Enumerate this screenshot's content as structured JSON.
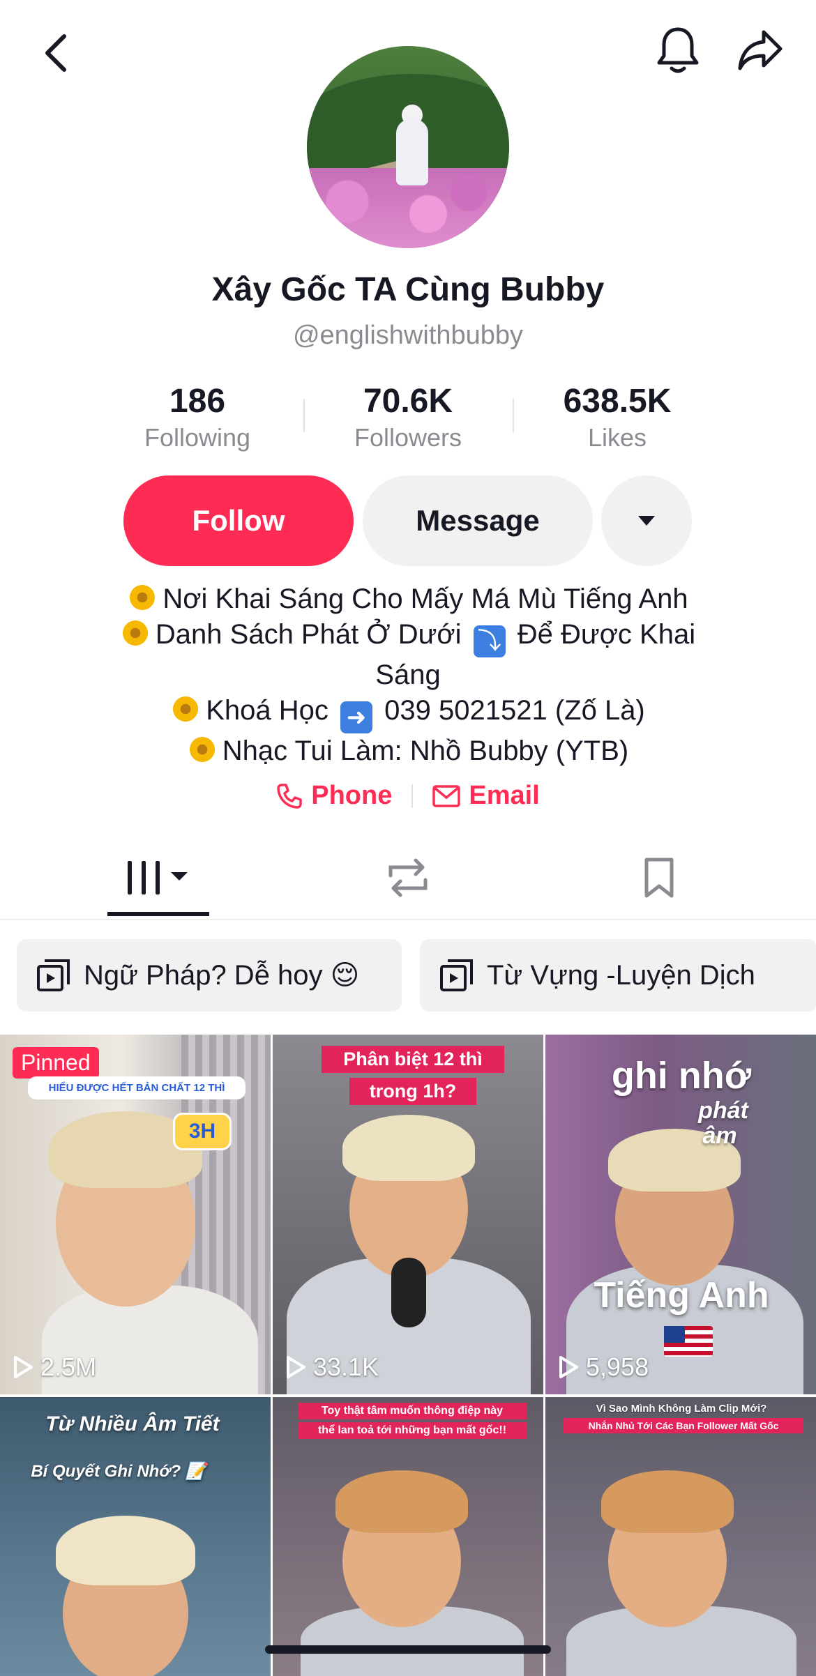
{
  "header": {
    "back_icon": "chevron-left-icon",
    "bell_icon": "bell-icon",
    "share_icon": "share-arrow-icon"
  },
  "profile": {
    "display_name": "Xây Gốc TA Cùng Bubby",
    "username": "@englishwithbubby"
  },
  "stats": [
    {
      "value": "186",
      "label": "Following"
    },
    {
      "value": "70.6K",
      "label": "Followers"
    },
    {
      "value": "638.5K",
      "label": "Likes"
    }
  ],
  "actions": {
    "follow_label": "Follow",
    "message_label": "Message"
  },
  "bio": {
    "line1": "Nơi Khai Sáng Cho Mấy Má Mù Tiếng Anh",
    "line2a": "Danh Sách Phát Ở Dưới",
    "line2b": "Để Được Khai",
    "line3": "Sáng",
    "line4a": "Khoá Học",
    "line4b": "039 5021521 (Zố Là)",
    "line5": "Nhạc Tui Làm: Nhồ Bubby (YTB)"
  },
  "contacts": {
    "phone_label": "Phone",
    "email_label": "Email"
  },
  "tabs": {
    "videos_icon": "grid-icon",
    "repost_icon": "repost-icon",
    "saved_icon": "bookmark-icon"
  },
  "playlists": [
    {
      "label": "Ngữ Pháp? Dễ hoy 😌"
    },
    {
      "label": "Từ Vựng -Luyện Dịch"
    }
  ],
  "videos": [
    {
      "views": "2.5M",
      "badge": "Pinned",
      "caption": "HIỂU ĐƯỢC HẾT BẢN CHẤT 12 THÌ",
      "tag": "3H"
    },
    {
      "views": "33.1K",
      "caption1": "Phân biệt 12 thì",
      "caption2": "trong 1h?"
    },
    {
      "views": "5,958",
      "caption1": "ghi nhớ",
      "caption2": "phát",
      "caption3": "âm",
      "caption4": "Tiếng Anh"
    },
    {
      "caption1": "Từ Nhiều Âm Tiết",
      "caption2": "Bí Quyết Ghi Nhớ? 📝"
    },
    {
      "caption1": "Toy thật tâm muốn thông điệp này",
      "caption2": "thể lan toả tới những bạn mất gốc!!"
    },
    {
      "caption1": "Vì Sao Mình Không Làm Clip Mới?",
      "caption2": "Nhắn Nhủ Tới Các Bạn Follower Mất Gốc"
    }
  ],
  "colors": {
    "accent": "#fe2c55",
    "text": "#161823",
    "muted": "#8a8b91"
  }
}
